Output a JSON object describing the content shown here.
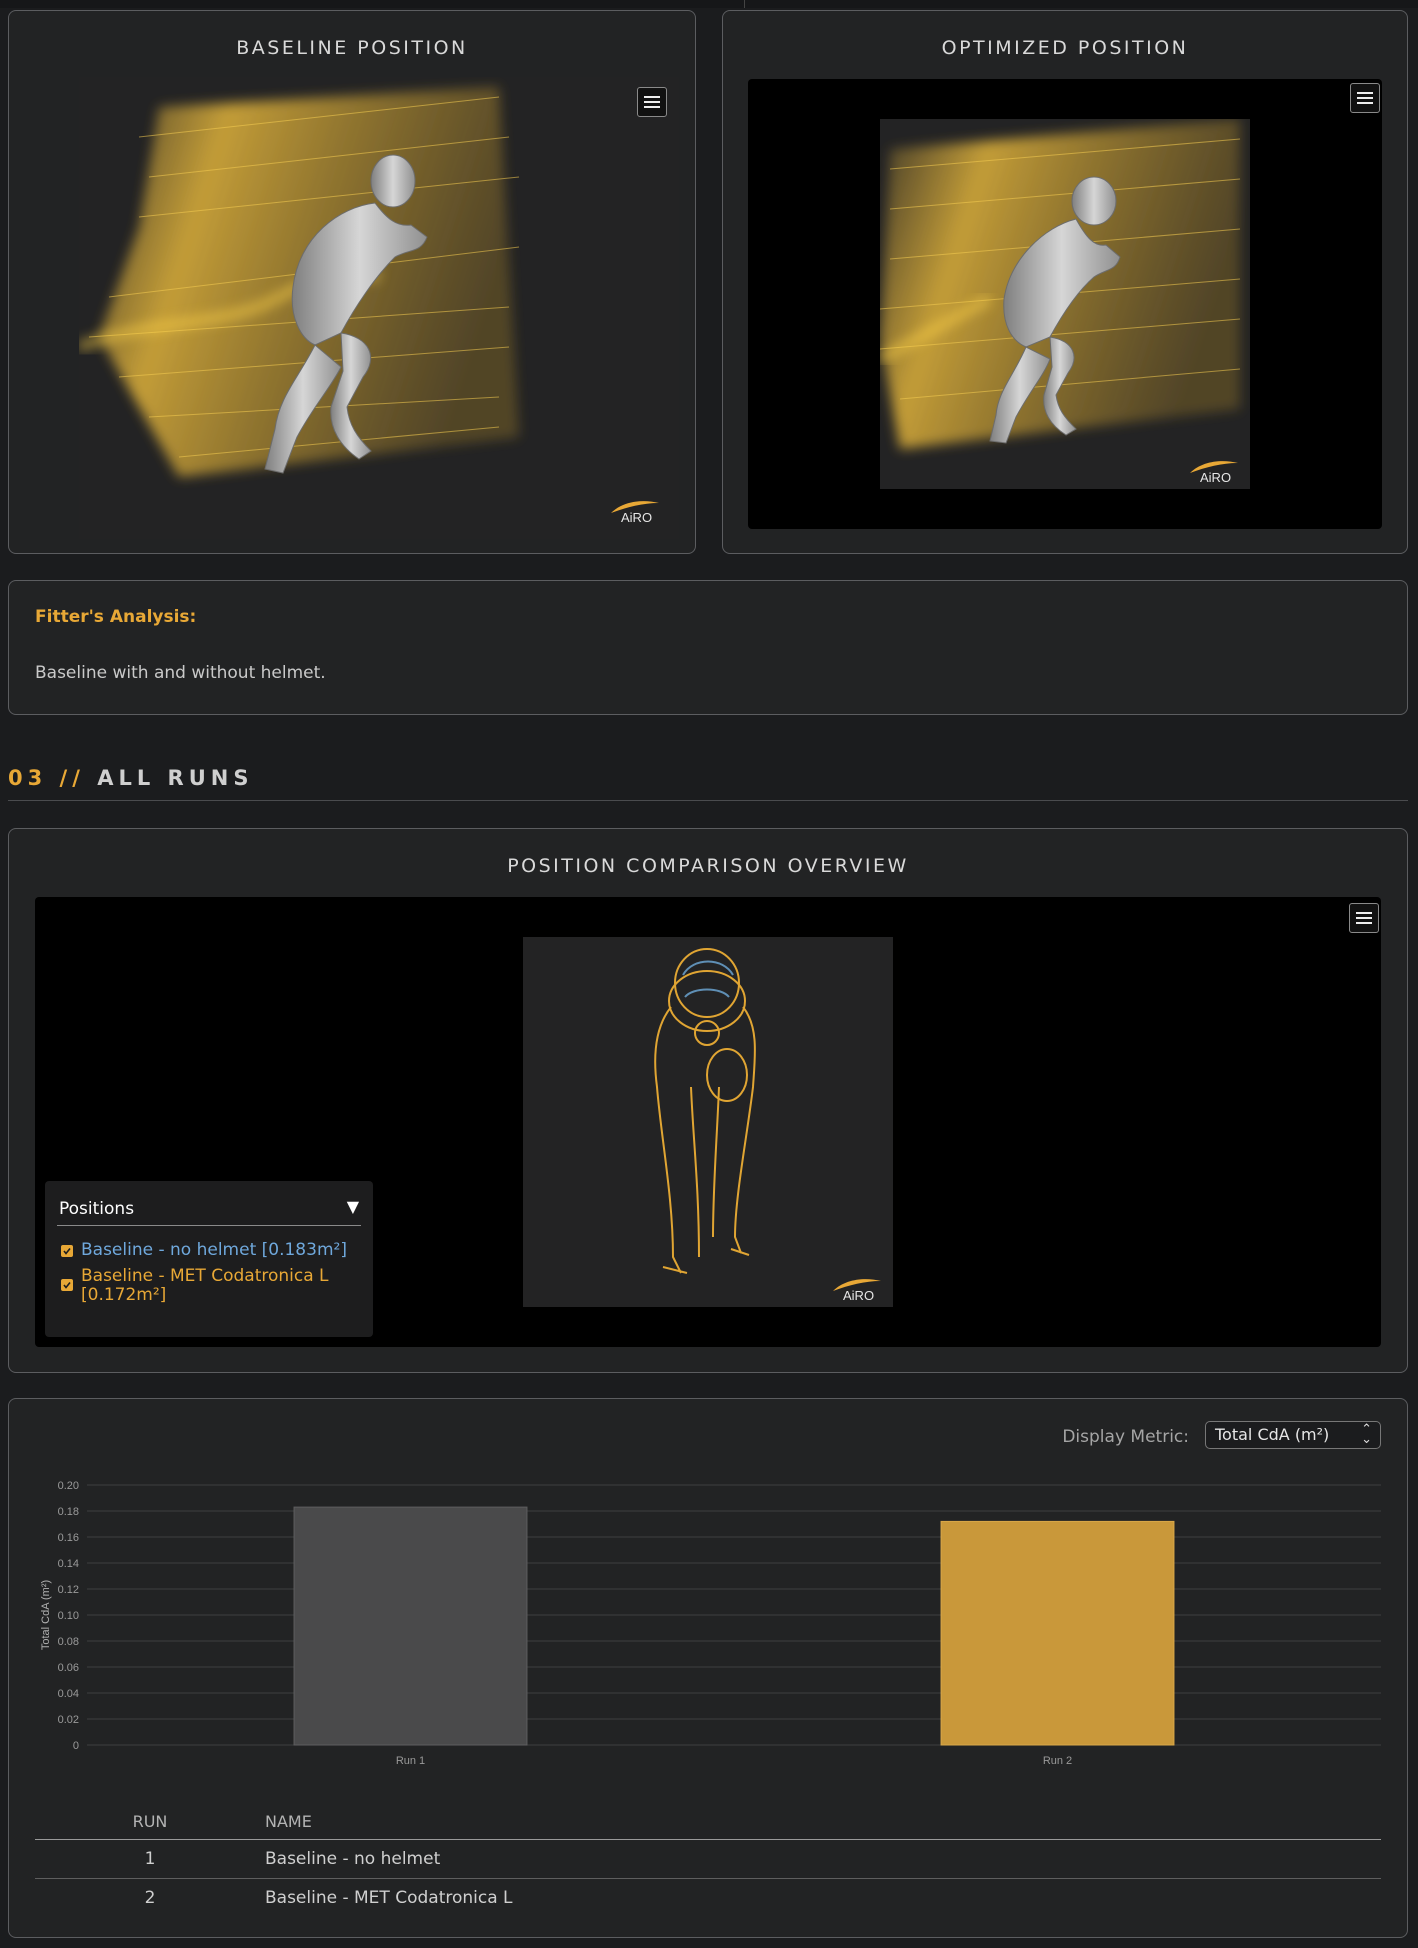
{
  "panels": {
    "baseline": {
      "title": "BASELINE POSITION"
    },
    "optimized": {
      "title": "OPTIMIZED POSITION"
    }
  },
  "brand": {
    "logo_text": "AiRO",
    "accent_color": "#e8a836"
  },
  "fitter": {
    "label": "Fitter's Analysis:",
    "text": "Baseline with and without helmet."
  },
  "section": {
    "number": "03",
    "separator": " // ",
    "title": "ALL RUNS"
  },
  "overview": {
    "title": "POSITION COMPARISON OVERVIEW",
    "legend": {
      "title": "Positions",
      "toggle_glyph": "▼",
      "items": [
        {
          "label": "Baseline - no helmet [0.183m²]",
          "color": "#6fa8dc",
          "checked": true
        },
        {
          "label": "Baseline - MET Codatronica L [0.172m²]",
          "color": "#e8a836",
          "checked": true
        }
      ]
    }
  },
  "metric": {
    "label": "Display Metric:",
    "selected": "Total CdA (m²)"
  },
  "chart_data": {
    "type": "bar",
    "categories": [
      "Run 1",
      "Run 2"
    ],
    "values": [
      0.183,
      0.172
    ],
    "bar_colors": [
      "#4a4a4b",
      "#c9983a"
    ],
    "ylabel": "Total CdA (m²)",
    "xlabel": "",
    "ylim": [
      0,
      0.2
    ],
    "yticks": [
      "0",
      "0.02",
      "0.04",
      "0.06",
      "0.08",
      "0.10",
      "0.12",
      "0.14",
      "0.16",
      "0.18",
      "0.20"
    ],
    "grid": true
  },
  "table": {
    "headers": {
      "run": "RUN",
      "name": "NAME"
    },
    "rows": [
      {
        "run": "1",
        "name": "Baseline - no helmet"
      },
      {
        "run": "2",
        "name": "Baseline - MET Codatronica L"
      }
    ]
  }
}
